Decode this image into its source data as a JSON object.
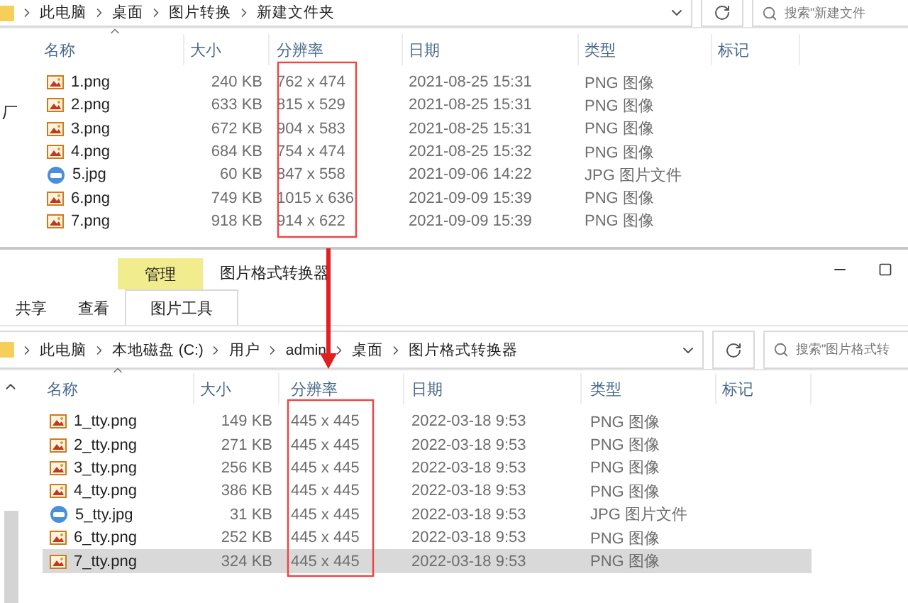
{
  "top_window": {
    "breadcrumb": [
      "此电脑",
      "桌面",
      "图片转换",
      "新建文件夹"
    ],
    "search": {
      "placeholder": "搜索\"新建文件"
    },
    "sidebar_fragment": "厂",
    "columns": [
      "名称",
      "大小",
      "分辨率",
      "日期",
      "类型",
      "标记"
    ],
    "files": [
      {
        "name": "1.png",
        "size": "240 KB",
        "resolution": "762 x 474",
        "date": "2021-08-25 15:31",
        "type": "PNG 图像",
        "kind": "png",
        "selected": false
      },
      {
        "name": "2.png",
        "size": "633 KB",
        "resolution": "815 x 529",
        "date": "2021-08-25 15:31",
        "type": "PNG 图像",
        "kind": "png",
        "selected": false
      },
      {
        "name": "3.png",
        "size": "672 KB",
        "resolution": "904 x 583",
        "date": "2021-08-25 15:31",
        "type": "PNG 图像",
        "kind": "png",
        "selected": false
      },
      {
        "name": "4.png",
        "size": "684 KB",
        "resolution": "754 x 474",
        "date": "2021-08-25 15:32",
        "type": "PNG 图像",
        "kind": "png",
        "selected": false
      },
      {
        "name": "5.jpg",
        "size": "60 KB",
        "resolution": "847 x 558",
        "date": "2021-09-06 14:22",
        "type": "JPG 图片文件",
        "kind": "jpg",
        "selected": false
      },
      {
        "name": "6.png",
        "size": "749 KB",
        "resolution": "1015 x 636",
        "date": "2021-09-09 15:39",
        "type": "PNG 图像",
        "kind": "png",
        "selected": false
      },
      {
        "name": "7.png",
        "size": "918 KB",
        "resolution": "914 x 622",
        "date": "2021-09-09 15:39",
        "type": "PNG 图像",
        "kind": "png",
        "selected": false
      }
    ]
  },
  "bottom_window": {
    "context_tab": "管理",
    "title": "图片格式转换器",
    "ribbon_tabs": [
      {
        "label": "共享",
        "selected": false
      },
      {
        "label": "查看",
        "selected": false
      },
      {
        "label": "图片工具",
        "selected": true
      }
    ],
    "breadcrumb": [
      "此电脑",
      "本地磁盘 (C:)",
      "用户",
      "admin",
      "桌面",
      "图片格式转换器"
    ],
    "search": {
      "placeholder": "搜索\"图片格式转"
    },
    "columns": [
      "名称",
      "大小",
      "分辨率",
      "日期",
      "类型",
      "标记"
    ],
    "files": [
      {
        "name": "1_tty.png",
        "size": "149 KB",
        "resolution": "445 x 445",
        "date": "2022-03-18 9:53",
        "type": "PNG 图像",
        "kind": "png",
        "selected": false
      },
      {
        "name": "2_tty.png",
        "size": "271 KB",
        "resolution": "445 x 445",
        "date": "2022-03-18 9:53",
        "type": "PNG 图像",
        "kind": "png",
        "selected": false
      },
      {
        "name": "3_tty.png",
        "size": "256 KB",
        "resolution": "445 x 445",
        "date": "2022-03-18 9:53",
        "type": "PNG 图像",
        "kind": "png",
        "selected": false
      },
      {
        "name": "4_tty.png",
        "size": "386 KB",
        "resolution": "445 x 445",
        "date": "2022-03-18 9:53",
        "type": "PNG 图像",
        "kind": "png",
        "selected": false
      },
      {
        "name": "5_tty.jpg",
        "size": "31 KB",
        "resolution": "445 x 445",
        "date": "2022-03-18 9:53",
        "type": "JPG 图片文件",
        "kind": "jpg",
        "selected": false
      },
      {
        "name": "6_tty.png",
        "size": "252 KB",
        "resolution": "445 x 445",
        "date": "2022-03-18 9:53",
        "type": "PNG 图像",
        "kind": "png",
        "selected": false
      },
      {
        "name": "7_tty.png",
        "size": "324 KB",
        "resolution": "445 x 445",
        "date": "2022-03-18 9:53",
        "type": "PNG 图像",
        "kind": "png",
        "selected": true
      }
    ]
  }
}
